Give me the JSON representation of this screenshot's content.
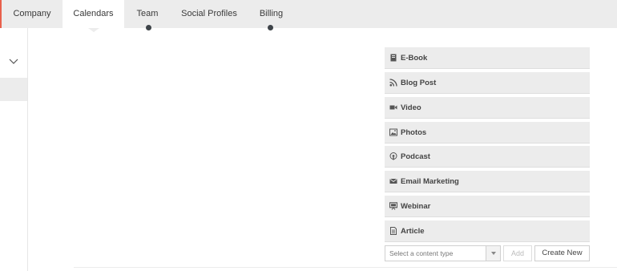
{
  "tabs": [
    {
      "label": "Company"
    },
    {
      "label": "Calendars"
    },
    {
      "label": "Team"
    },
    {
      "label": "Social Profiles"
    },
    {
      "label": "Billing"
    }
  ],
  "active_tab": "Calendars",
  "accent_color": "#e8604c",
  "content_types": [
    {
      "label": "E-Book",
      "icon": "book-icon"
    },
    {
      "label": "Blog Post",
      "icon": "rss-icon"
    },
    {
      "label": "Video",
      "icon": "video-camera-icon"
    },
    {
      "label": "Photos",
      "icon": "photo-icon"
    },
    {
      "label": "Podcast",
      "icon": "podcast-icon"
    },
    {
      "label": "Email Marketing",
      "icon": "envelope-icon"
    },
    {
      "label": "Webinar",
      "icon": "presentation-icon"
    },
    {
      "label": "Article",
      "icon": "document-icon"
    }
  ],
  "controls": {
    "select_placeholder": "Select a content type",
    "add_label": "Add",
    "create_label": "Create New"
  }
}
